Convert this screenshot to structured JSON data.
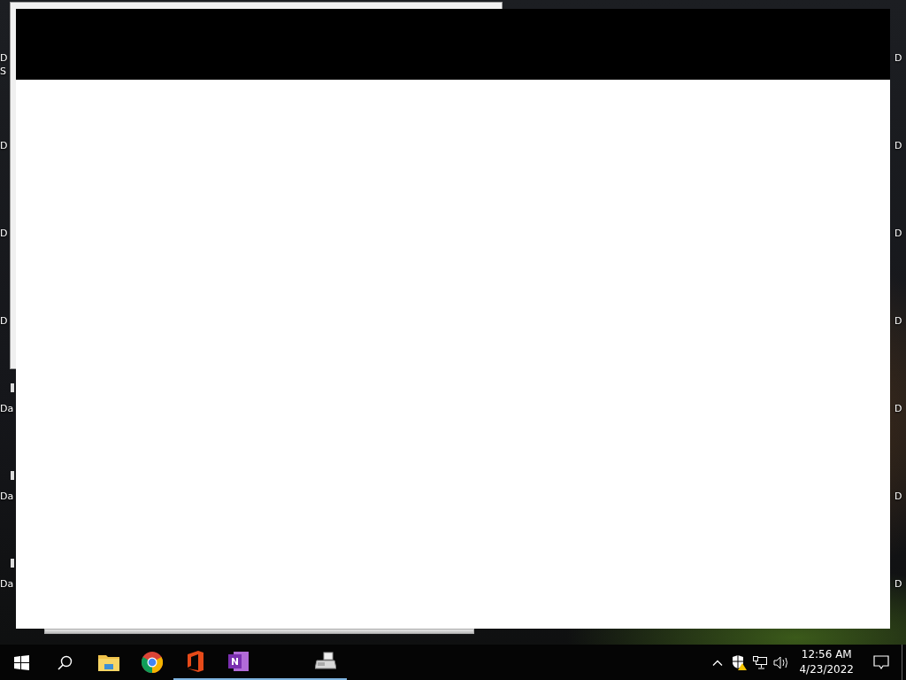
{
  "desktop_icons_left": [
    {
      "label_lines": [
        "D",
        "S"
      ],
      "kind": "covered"
    },
    {
      "label_lines": [
        "D"
      ],
      "kind": "covered"
    },
    {
      "label_lines": [
        "D"
      ],
      "kind": "covered"
    },
    {
      "label_lines": [
        "D"
      ],
      "kind": "covered"
    },
    {
      "label_lines": [
        "Da"
      ],
      "kind": "partial"
    },
    {
      "label_lines": [
        "Da"
      ],
      "kind": "partial"
    },
    {
      "label_lines": [
        "Da"
      ],
      "kind": "partial"
    }
  ],
  "desktop_icons_right": [
    {
      "label": "D"
    },
    {
      "label": "D"
    },
    {
      "label": "D"
    },
    {
      "label": "D"
    },
    {
      "label": "D"
    },
    {
      "label": "D"
    },
    {
      "label": "D"
    }
  ],
  "taskbar": {
    "apps": [
      {
        "kind": "explorer",
        "running": false
      },
      {
        "kind": "chrome",
        "running": false
      },
      {
        "kind": "office",
        "running": true
      },
      {
        "kind": "onenote",
        "running": true
      },
      {
        "kind": "blank",
        "running": true
      },
      {
        "kind": "fax",
        "running": true
      }
    ],
    "tray": {
      "time": "12:56 AM",
      "date": "4/23/2022"
    }
  }
}
